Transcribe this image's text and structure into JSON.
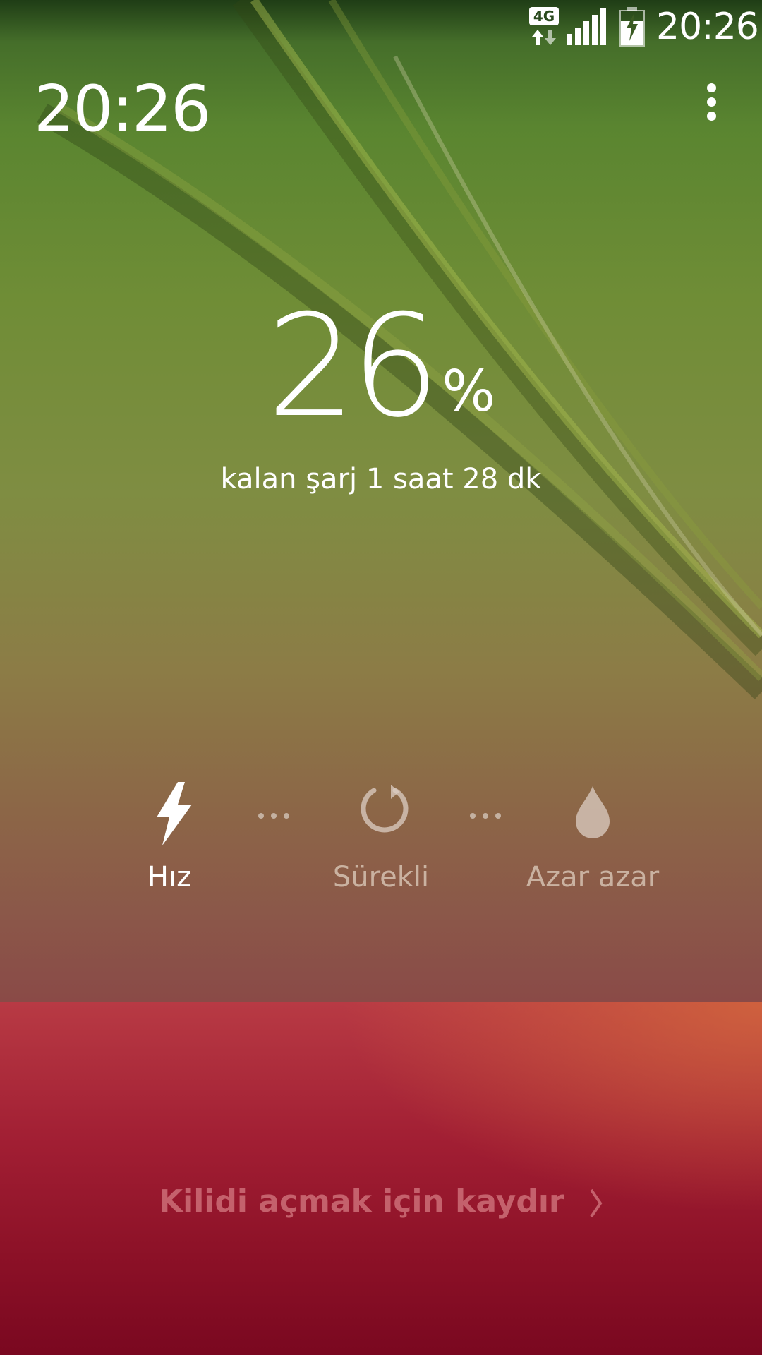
{
  "status_bar": {
    "network": "4G",
    "time": "20:26",
    "icons": [
      "data-arrows-icon",
      "signal-icon",
      "battery-charging-icon"
    ]
  },
  "lock_screen": {
    "clock": "20:26",
    "menu_icon": "more-vert-icon"
  },
  "battery": {
    "percent": "26",
    "percent_sign": "%",
    "remaining": "kalan şarj 1 saat 28 dk"
  },
  "charge_modes": [
    {
      "label": "Hız",
      "icon": "lightning-icon",
      "active": true
    },
    {
      "label": "Sürekli",
      "icon": "refresh-icon",
      "active": false
    },
    {
      "label": "Azar azar",
      "icon": "drop-icon",
      "active": false
    }
  ],
  "unlock": {
    "text": "Kilidi açmak için kaydır",
    "icon": "chevron-right-icon"
  },
  "colors": {
    "top_background": "#5a8530",
    "bottom_panel": "#a11e33",
    "inactive_text": "#e6d7c8"
  }
}
